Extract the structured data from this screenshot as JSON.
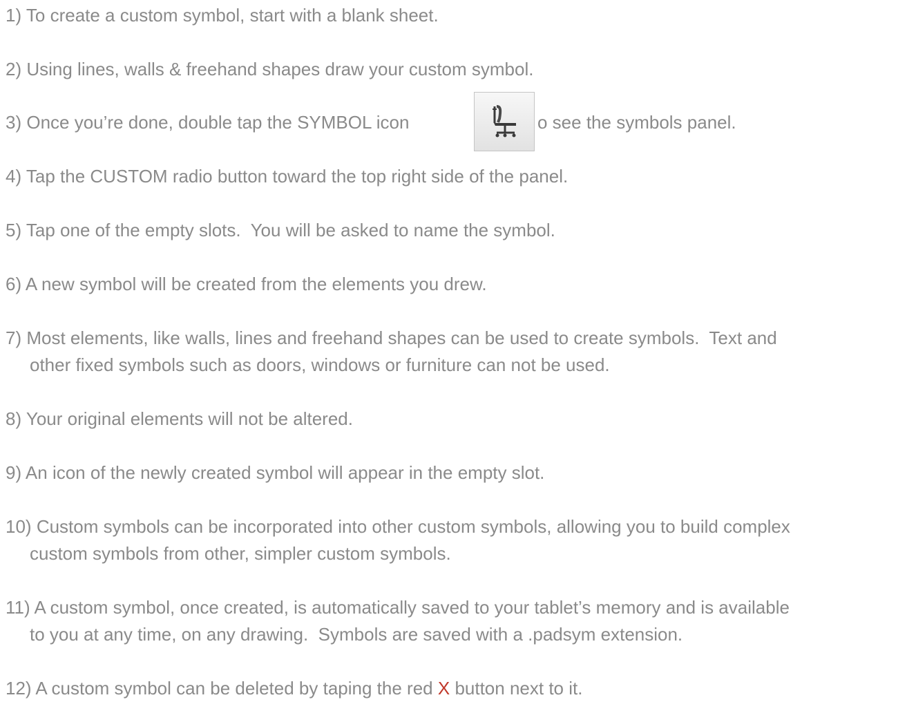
{
  "steps": [
    {
      "num": "1)",
      "text": "To create a custom symbol, start with a blank sheet."
    },
    {
      "num": "2)",
      "text": "Using lines, walls & freehand shapes draw your custom symbol."
    },
    {
      "num": "3)",
      "text_before_icon": "Once you’re done, double tap the SYMBOL icon",
      "text_after_icon": "o see the symbols panel.",
      "icon": "office-chair-icon"
    },
    {
      "num": "4)",
      "text": "Tap the CUSTOM radio button toward the top right side of the panel."
    },
    {
      "num": "5)",
      "text": "Tap one of the empty slots.  You will be asked to name the symbol."
    },
    {
      "num": "6)",
      "text": "A new symbol will be created from the elements you drew."
    },
    {
      "num": "7)",
      "line1": "Most elements, like walls, lines and freehand shapes can be used to create symbols.  Text and",
      "line2": "other fixed symbols such as doors, windows or furniture can not be used."
    },
    {
      "num": "8)",
      "text": "Your original elements will not be altered."
    },
    {
      "num": "9)",
      "text": "An icon of the newly created symbol will appear in the empty slot."
    },
    {
      "num": "10)",
      "line1": "Custom symbols can be incorporated into other custom symbols, allowing you to build complex",
      "line2": "custom symbols from other, simpler custom symbols."
    },
    {
      "num": "11)",
      "line1": "A custom symbol, once created, is automatically saved to your tablet’s memory and is available",
      "line2": "to you at any time, on any drawing.  Symbols are saved with a .padsym extension."
    },
    {
      "num": "12)",
      "text_before": "A custom symbol can be deleted by taping the red",
      "red_mark": "X",
      "text_after": "button next to it."
    }
  ],
  "colors": {
    "text": "#8a8a8a",
    "delete_mark": "#c0392b"
  }
}
